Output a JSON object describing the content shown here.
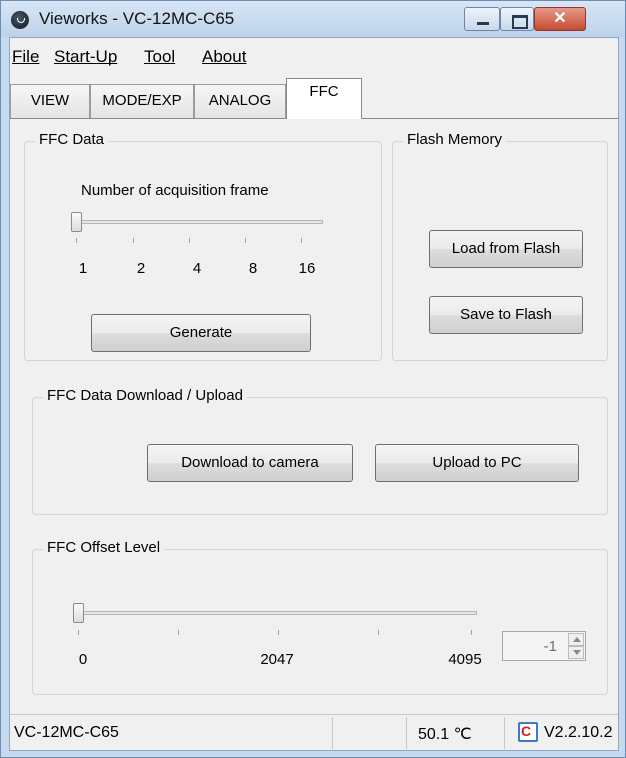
{
  "window": {
    "title": "Vieworks - VC-12MC-C65",
    "icon": "vieworks-logo-icon",
    "controls": [
      "minimize-icon",
      "maximize-icon",
      "close-icon"
    ],
    "close_glyph": "✕"
  },
  "menu": {
    "file": "File",
    "startup": "Start-Up",
    "tool": "Tool",
    "about": "About"
  },
  "tabs": [
    {
      "label": "VIEW"
    },
    {
      "label": "MODE/EXP"
    },
    {
      "label": "ANALOG"
    },
    {
      "label": "FFC",
      "active": true
    }
  ],
  "ffc_data": {
    "title": "FFC Data",
    "slider_label": "Number of acquisition frame",
    "slider_ticks": [
      "1",
      "2",
      "4",
      "8",
      "16"
    ],
    "slider_value": "1",
    "generate_button": "Generate"
  },
  "flash_memory": {
    "title": "Flash Memory",
    "load_button": "Load from Flash",
    "save_button": "Save to Flash"
  },
  "download_upload": {
    "title": "FFC Data Download / Upload",
    "download_button": "Download to camera",
    "upload_button": "Upload to PC"
  },
  "offset_level": {
    "title": "FFC Offset Level",
    "slider_ticks": [
      "0",
      "2047",
      "4095"
    ],
    "slider_value": 0,
    "spin_value": "-1"
  },
  "status": {
    "model": "VC-12MC-C65",
    "temperature": "50.1 ℃",
    "version": "V2.2.10.2",
    "temp_icon_letter": "C"
  },
  "colors": {
    "title_bar": "#c5d9ef",
    "close_button": "#c64a32",
    "panel": "#f0f0f0"
  }
}
